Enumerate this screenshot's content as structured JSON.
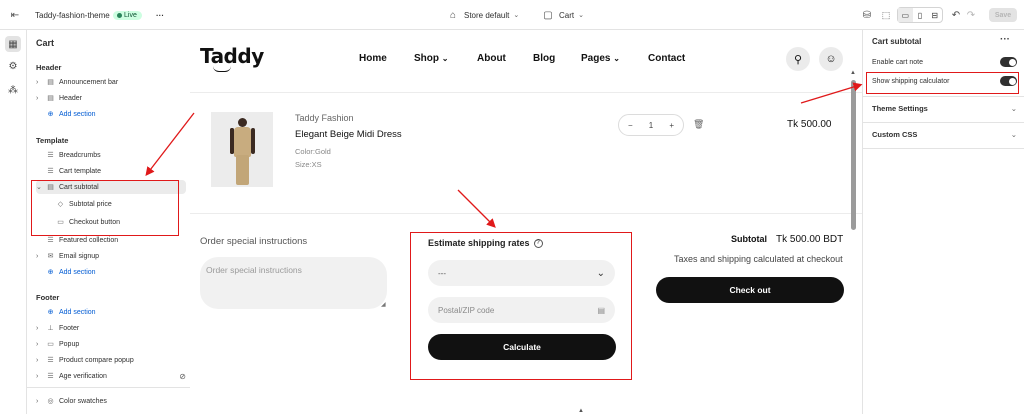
{
  "topbar": {
    "theme_name": "Taddy-fashion-theme",
    "live_label": "Live",
    "more": "···",
    "store_select": "Store default",
    "page_select": "Cart",
    "save_label": "Save"
  },
  "left_panel": {
    "title": "Cart",
    "header_section": "Header",
    "header_items": [
      "Announcement bar",
      "Header"
    ],
    "add_section": "Add section",
    "template_section": "Template",
    "template_items": [
      "Breadcrumbs",
      "Cart template",
      "Cart subtotal",
      "Subtotal price",
      "Checkout button",
      "Featured collection",
      "Email signup"
    ],
    "footer_section": "Footer",
    "footer_items": [
      "Footer",
      "Popup",
      "Product compare popup",
      "Age verification"
    ],
    "bottom_item": "Color swatches"
  },
  "store": {
    "logo": "Taddy",
    "nav": [
      "Home",
      "Shop",
      "About",
      "Blog",
      "Pages",
      "Contact"
    ],
    "product": {
      "vendor": "Taddy Fashion",
      "name": "Elegant Beige Midi Dress",
      "color": "Color:Gold",
      "size": "Size:XS",
      "qty": "1",
      "minus": "−",
      "plus": "+",
      "price": "Tk 500.00"
    },
    "order_instructions_label": "Order special instructions",
    "order_instructions_placeholder": "Order special instructions",
    "shipping": {
      "title": "Estimate shipping rates",
      "country_value": "---",
      "zip_placeholder": "Postal/ZIP code",
      "calculate_label": "Calculate"
    },
    "subtotal_label": "Subtotal",
    "subtotal_value": "Tk 500.00 BDT",
    "tax_note": "Taxes and shipping calculated at checkout",
    "checkout_label": "Check out"
  },
  "right_panel": {
    "title": "Cart subtotal",
    "more": "···",
    "enable_cart_note": "Enable cart note",
    "show_shipping_calc": "Show shipping calculator",
    "theme_settings": "Theme Settings",
    "custom_css": "Custom CSS"
  },
  "colors": {
    "annotation_red": "#e0191a",
    "live_green": "#29845a",
    "button_dark": "#111111"
  }
}
